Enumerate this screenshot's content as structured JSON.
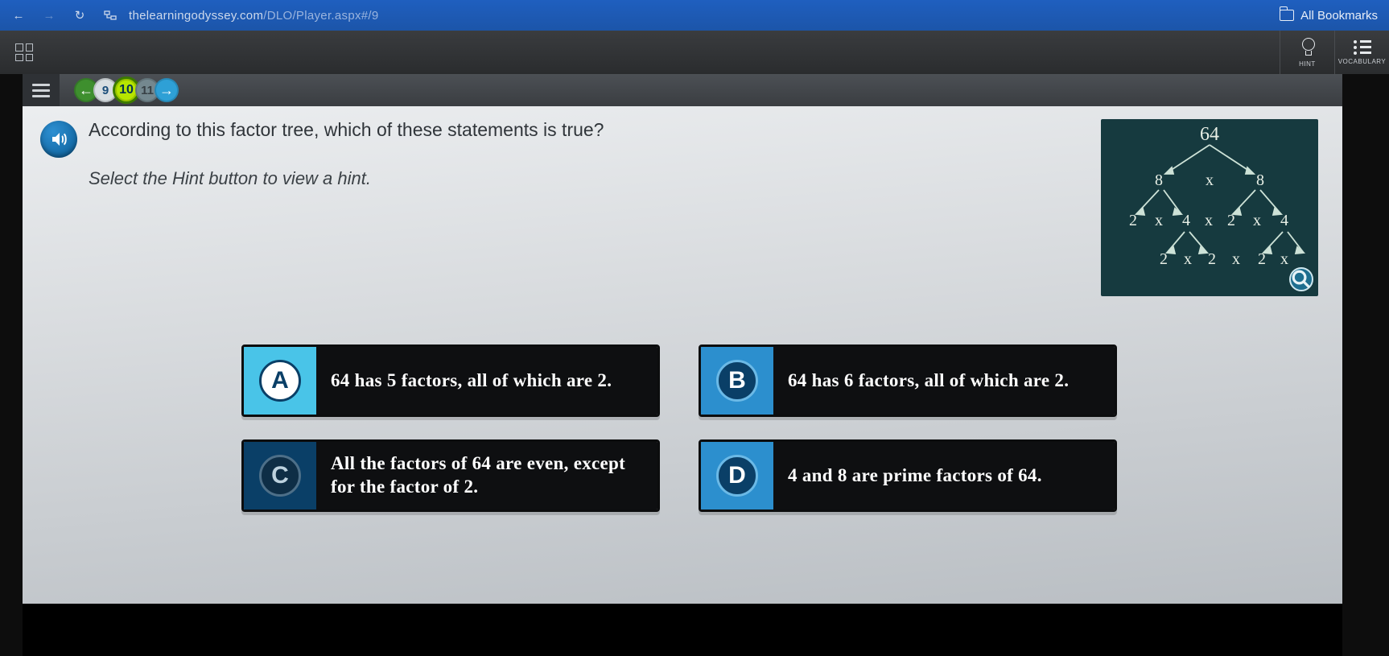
{
  "browser": {
    "url_prefix": "thelearningodyssey.com",
    "url_path": "/DLO/Player.aspx#/9",
    "bookmarks_label": "All Bookmarks"
  },
  "toolbar": {
    "hint_label": "HINT",
    "vocab_label": "VOCABULARY"
  },
  "breadcrumb": {
    "prev": "9",
    "current": "10",
    "next": "11"
  },
  "question": {
    "prompt": "According to this factor tree, which of these statements is true?",
    "sub": "Select the Hint button to view a hint."
  },
  "factor_tree": {
    "root": "64",
    "level1": [
      "8",
      "x",
      "8"
    ],
    "level2": [
      "2",
      "x",
      "4",
      "x",
      "2",
      "x",
      "4"
    ],
    "level3": [
      "2",
      "x",
      "2",
      "x",
      "2",
      "x"
    ]
  },
  "answers": {
    "a": {
      "letter": "A",
      "text": "64 has 5 factors, all of which are 2."
    },
    "b": {
      "letter": "B",
      "text": "64 has 6 factors, all of which are 2."
    },
    "c": {
      "letter": "C",
      "text": "All the factors of 64 are even, except for the factor of 2."
    },
    "d": {
      "letter": "D",
      "text": "4 and 8 are prime factors of 64."
    }
  }
}
